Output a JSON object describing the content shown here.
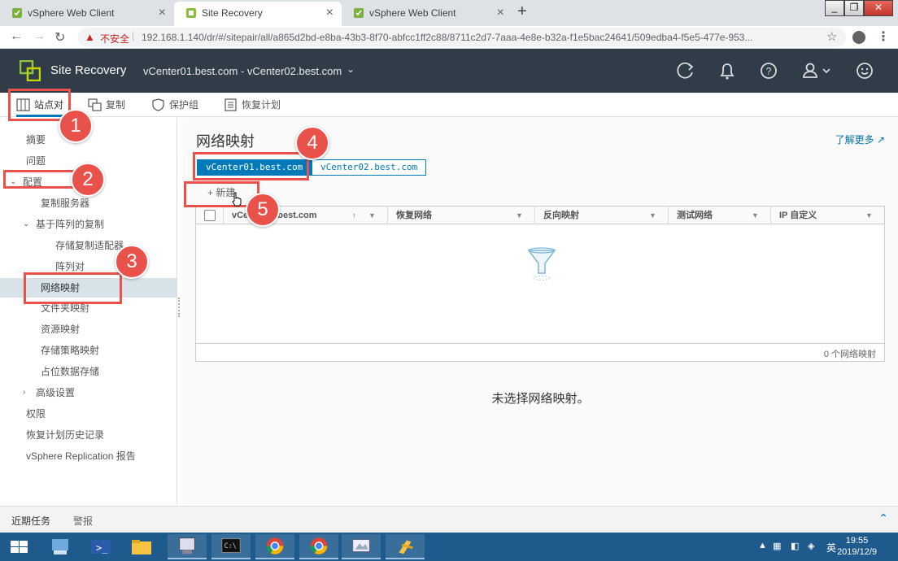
{
  "browser": {
    "tabs": [
      {
        "title": "vSphere Web Client",
        "active": false
      },
      {
        "title": "Site Recovery",
        "active": true
      },
      {
        "title": "vSphere Web Client",
        "active": false
      }
    ],
    "security_label": "不安全",
    "url": "192.168.1.140/dr/#/sitepair/all/a865d2bd-e8ba-43b3-8f70-abfcc1ff2c88/8711c2d7-7aaa-4e8e-b32a-f1e5bac24641/509edba4-f5e5-477e-953..."
  },
  "app": {
    "name": "Site Recovery",
    "site_pair": "vCenter01.best.com - vCenter02.best.com",
    "header_icons": [
      "refresh-icon",
      "bell-icon",
      "help-icon",
      "user-icon",
      "smiley-icon"
    ],
    "brand_color": "#303d48",
    "accent_color": "#0079b8"
  },
  "tabs": [
    {
      "label": "站点对",
      "icon": "site-pair-icon",
      "active": true
    },
    {
      "label": "复制",
      "icon": "replication-icon",
      "active": false
    },
    {
      "label": "保护组",
      "icon": "shield-icon",
      "active": false
    },
    {
      "label": "恢复计划",
      "icon": "recovery-plan-icon",
      "active": false
    }
  ],
  "sidebar": {
    "items": [
      {
        "label": "摘要"
      },
      {
        "label": "问题"
      },
      {
        "label": "配置"
      },
      {
        "label": "复制服务器"
      },
      {
        "label": "基于阵列的复制"
      },
      {
        "label": "存储复制适配器"
      },
      {
        "label": "阵列对"
      },
      {
        "label": "网络映射"
      },
      {
        "label": "文件夹映射"
      },
      {
        "label": "资源映射"
      },
      {
        "label": "存储策略映射"
      },
      {
        "label": "占位数据存储"
      },
      {
        "label": "高级设置"
      },
      {
        "label": "权限"
      },
      {
        "label": "恢复计划历史记录"
      },
      {
        "label": "vSphere Replication 报告"
      }
    ]
  },
  "main": {
    "title": "网络映射",
    "learn_more": "了解更多",
    "vcenter_buttons": [
      {
        "label": "vCenter01.best.com",
        "active": true
      },
      {
        "label": "vCenter02.best.com",
        "active": false
      }
    ],
    "new_button": "新建",
    "grid": {
      "columns": [
        "vCenter01.best.com",
        "恢复网络",
        "反向映射",
        "测试网络",
        "IP 自定义"
      ],
      "rows": [],
      "footer": "0 个网络映射"
    },
    "no_selection": "未选择网络映射。"
  },
  "recent": {
    "tasks_label": "近期任务",
    "alarms_label": "警报"
  },
  "windows": {
    "time": "19:55",
    "date": "2019/12/9",
    "ime": "英"
  },
  "annotations": [
    "1",
    "2",
    "3",
    "4",
    "5"
  ]
}
